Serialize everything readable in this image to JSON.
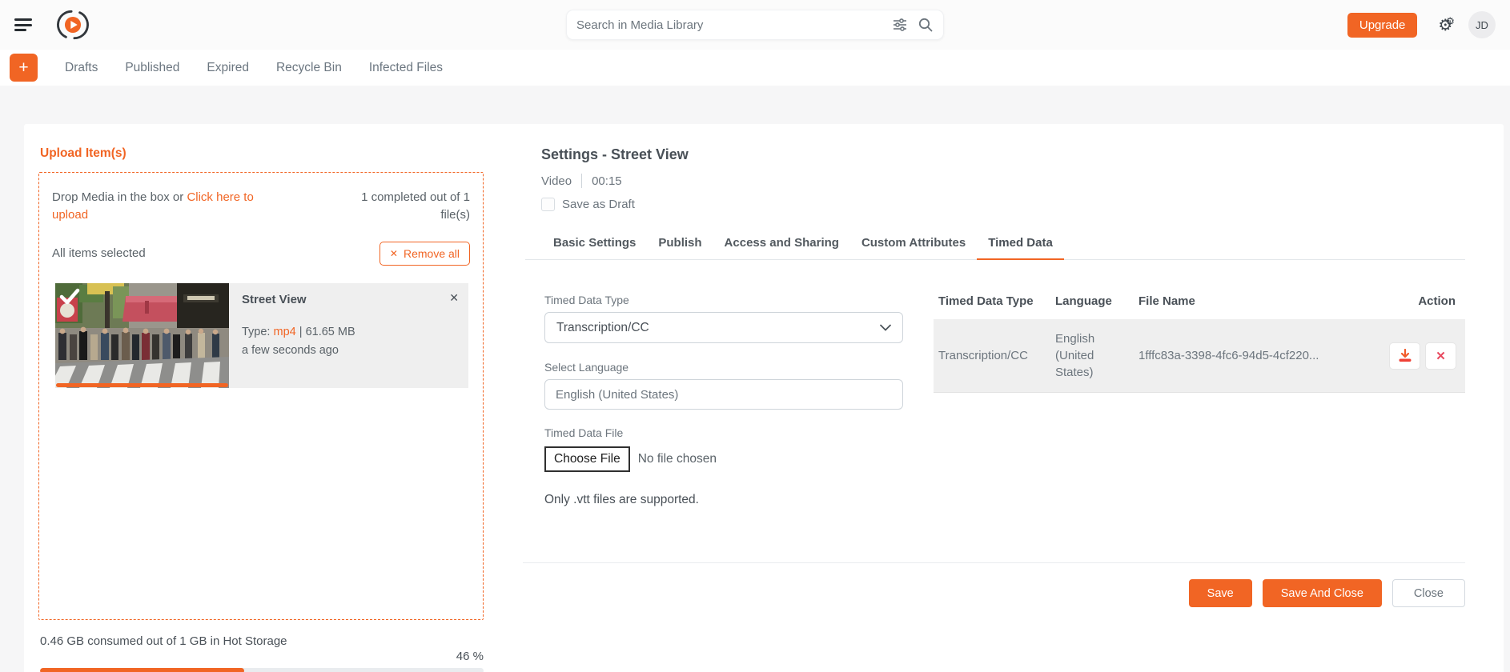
{
  "colors": {
    "accent": "#f16524",
    "danger": "#e8495f",
    "text_dark": "#495057",
    "text_gray": "#6c757d",
    "row_bg": "#efefef"
  },
  "icons": {
    "hamburger": "menu-icon",
    "close_glyph": "✕",
    "plus_glyph": "+",
    "gear_glyph": "⚙",
    "check": "✓"
  },
  "topbar": {
    "search_placeholder": "Search in Media Library",
    "upgrade_label": "Upgrade",
    "avatar_initials": "JD"
  },
  "tabs_bar": {
    "items": [
      "Drafts",
      "Published",
      "Expired",
      "Recycle Bin",
      "Infected Files"
    ]
  },
  "upload_panel": {
    "title": "Upload Item(s)",
    "drop_text": "Drop Media in the box or",
    "drop_link": "Click here to upload",
    "progress_text": "1 completed out of 1 file(s)",
    "selected_text": "All items selected",
    "remove_all_label": "Remove all",
    "file": {
      "name": "Street View",
      "type_label": "Type:",
      "type": "mp4",
      "separator": "|",
      "size": "61.65 MB",
      "time": "a few seconds ago"
    },
    "storage": {
      "text": "0.46 GB consumed out of 1 GB in Hot Storage",
      "percent_label": "46 %",
      "percent": 46
    }
  },
  "settings_panel": {
    "title": "Settings - Street View",
    "media_type": "Video",
    "duration": "00:15",
    "save_as_draft_label": "Save as Draft",
    "tabs": [
      {
        "label": "Basic Settings",
        "active": false
      },
      {
        "label": "Publish",
        "active": false
      },
      {
        "label": "Access and Sharing",
        "active": false
      },
      {
        "label": "Custom Attributes",
        "active": false
      },
      {
        "label": "Timed Data",
        "active": true
      }
    ],
    "form": {
      "type_label": "Timed Data Type",
      "type_value": "Transcription/CC",
      "language_label": "Select Language",
      "language_value": "English (United States)",
      "file_label": "Timed Data File",
      "choose_file_label": "Choose File",
      "no_file_text": "No file chosen",
      "hint": "Only .vtt files are supported."
    },
    "table": {
      "headers": [
        "Timed Data Type",
        "Language",
        "File Name",
        "Action"
      ],
      "rows": [
        {
          "type": "Transcription/CC",
          "language": "English (United States)",
          "file_name": "1fffc83a-3398-4fc6-94d5-4cf220..."
        }
      ]
    },
    "footer": {
      "save": "Save",
      "save_and_close": "Save And Close",
      "close": "Close"
    }
  }
}
